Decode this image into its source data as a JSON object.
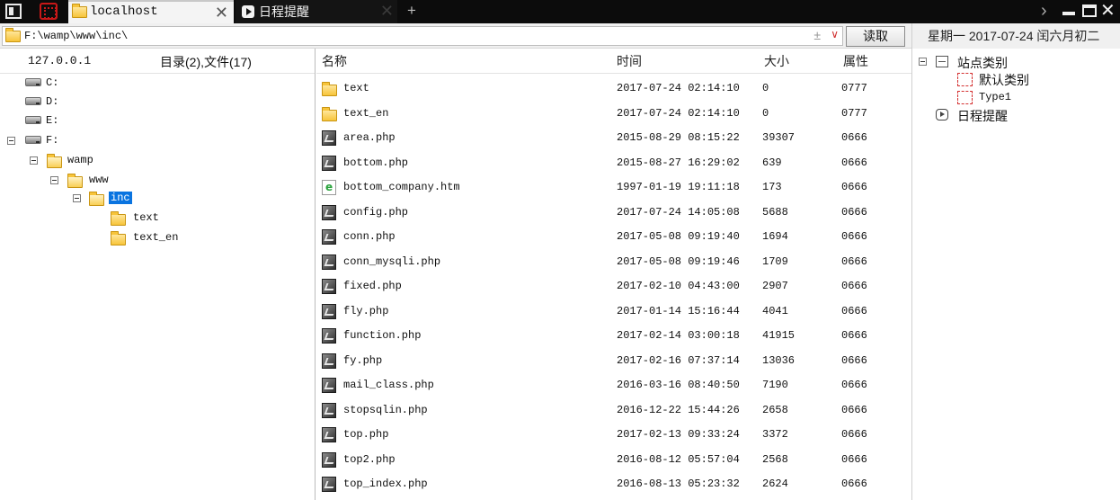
{
  "tabs": [
    {
      "label": "localhost",
      "active": true,
      "icon": "folder-icon"
    },
    {
      "label": "日程提醒",
      "active": false,
      "icon": "play-icon"
    }
  ],
  "address": {
    "path": "F:\\wamp\\www\\inc\\",
    "sort_glyph": "±",
    "dropdown_glyph": "∨",
    "read_button": "读取"
  },
  "date_text": "星期一 2017-07-24 闰六月初二",
  "left_panel": {
    "host": "127.0.0.1",
    "summary": "目录(2),文件(17)",
    "tree": [
      {
        "label": "C:",
        "type": "drive"
      },
      {
        "label": "D:",
        "type": "drive"
      },
      {
        "label": "E:",
        "type": "drive"
      },
      {
        "label": "F:",
        "type": "drive",
        "expanded": true
      },
      {
        "label": "wamp",
        "type": "folder",
        "expanded": true
      },
      {
        "label": "www",
        "type": "folder",
        "expanded": true
      },
      {
        "label": "inc",
        "type": "folder",
        "expanded": true,
        "selected": true
      },
      {
        "label": "text",
        "type": "folder"
      },
      {
        "label": "text_en",
        "type": "folder"
      }
    ]
  },
  "file_list": {
    "columns": [
      "名称",
      "时间",
      "大小",
      "属性"
    ],
    "rows": [
      {
        "name": "text",
        "type": "folder",
        "time": "2017-07-24 02:14:10",
        "size": "0",
        "attr": "0777"
      },
      {
        "name": "text_en",
        "type": "folder",
        "time": "2017-07-24 02:14:10",
        "size": "0",
        "attr": "0777"
      },
      {
        "name": "area.php",
        "type": "php",
        "time": "2015-08-29 08:15:22",
        "size": "39307",
        "attr": "0666"
      },
      {
        "name": "bottom.php",
        "type": "php",
        "time": "2015-08-27 16:29:02",
        "size": "639",
        "attr": "0666"
      },
      {
        "name": "bottom_company.htm",
        "type": "htm",
        "time": "1997-01-19 19:11:18",
        "size": "173",
        "attr": "0666"
      },
      {
        "name": "config.php",
        "type": "php",
        "time": "2017-07-24 14:05:08",
        "size": "5688",
        "attr": "0666"
      },
      {
        "name": "conn.php",
        "type": "php",
        "time": "2017-05-08 09:19:40",
        "size": "1694",
        "attr": "0666"
      },
      {
        "name": "conn_mysqli.php",
        "type": "php",
        "time": "2017-05-08 09:19:46",
        "size": "1709",
        "attr": "0666"
      },
      {
        "name": "fixed.php",
        "type": "php",
        "time": "2017-02-10 04:43:00",
        "size": "2907",
        "attr": "0666"
      },
      {
        "name": "fly.php",
        "type": "php",
        "time": "2017-01-14 15:16:44",
        "size": "4041",
        "attr": "0666"
      },
      {
        "name": "function.php",
        "type": "php",
        "time": "2017-02-14 03:00:18",
        "size": "41915",
        "attr": "0666"
      },
      {
        "name": "fy.php",
        "type": "php",
        "time": "2017-02-16 07:37:14",
        "size": "13036",
        "attr": "0666"
      },
      {
        "name": "mail_class.php",
        "type": "php",
        "time": "2016-03-16 08:40:50",
        "size": "7190",
        "attr": "0666"
      },
      {
        "name": "stopsqlin.php",
        "type": "php",
        "time": "2016-12-22 15:44:26",
        "size": "2658",
        "attr": "0666"
      },
      {
        "name": "top.php",
        "type": "php",
        "time": "2017-02-13 09:33:24",
        "size": "3372",
        "attr": "0666"
      },
      {
        "name": "top2.php",
        "type": "php",
        "time": "2016-08-12 05:57:04",
        "size": "2568",
        "attr": "0666"
      },
      {
        "name": "top_index.php",
        "type": "php",
        "time": "2016-08-13 05:23:32",
        "size": "2624",
        "attr": "0666"
      }
    ]
  },
  "right_panel": {
    "root_label": "站点类别",
    "categories": [
      "默认类别",
      "Type1"
    ],
    "schedule_label": "日程提醒"
  },
  "colors": {
    "titlebar": "#0c0c0c",
    "selection": "#0a74e0",
    "accent_red": "#c81818",
    "folder": "#f7c43a"
  }
}
